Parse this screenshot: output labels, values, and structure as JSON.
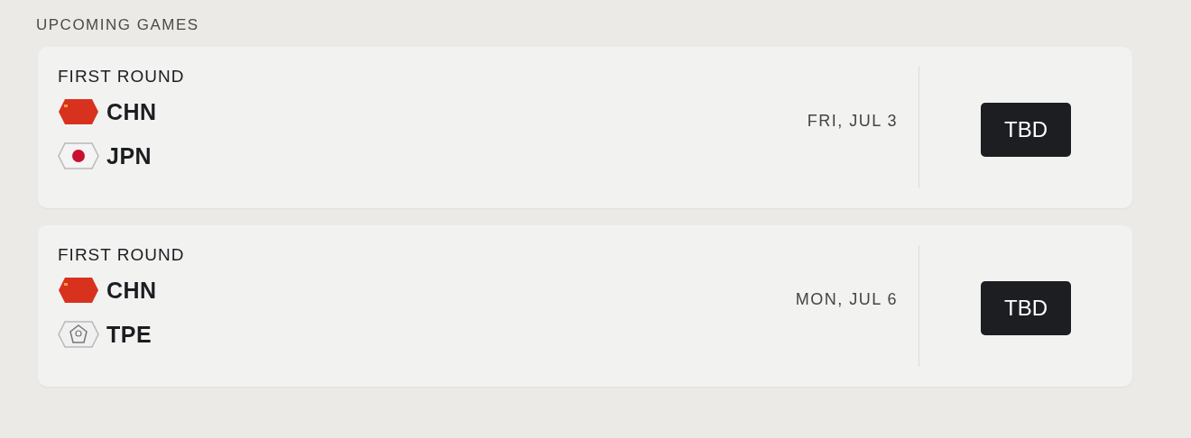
{
  "section_title": "UPCOMING GAMES",
  "games": [
    {
      "round": "FIRST ROUND",
      "teams": [
        {
          "code": "CHN",
          "kind": "red"
        },
        {
          "code": "JPN",
          "kind": "dot"
        }
      ],
      "date": "FRI, JUL 3",
      "action": "TBD"
    },
    {
      "round": "FIRST ROUND",
      "teams": [
        {
          "code": "CHN",
          "kind": "red"
        },
        {
          "code": "TPE",
          "kind": "emblem"
        }
      ],
      "date": "MON, JUL 6",
      "action": "TBD"
    }
  ]
}
